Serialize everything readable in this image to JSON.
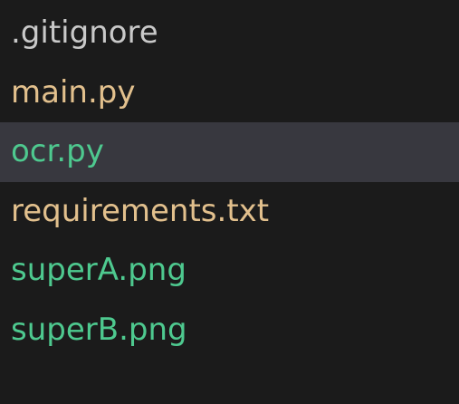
{
  "explorer": {
    "files": [
      {
        "name": ".gitignore",
        "status": "neutral",
        "color": "#c9c9c9"
      },
      {
        "name": "main.py",
        "status": "modified",
        "color": "#e2c08d"
      },
      {
        "name": "ocr.py",
        "status": "untracked",
        "color": "#4ec98f",
        "selected": true
      },
      {
        "name": "requirements.txt",
        "status": "modified",
        "color": "#e2c08d"
      },
      {
        "name": "superA.png",
        "status": "untracked",
        "color": "#4ec98f"
      },
      {
        "name": "superB.png",
        "status": "untracked",
        "color": "#4ec98f"
      }
    ],
    "colors": {
      "background": "#1b1b1b",
      "selection": "#38383f"
    }
  }
}
